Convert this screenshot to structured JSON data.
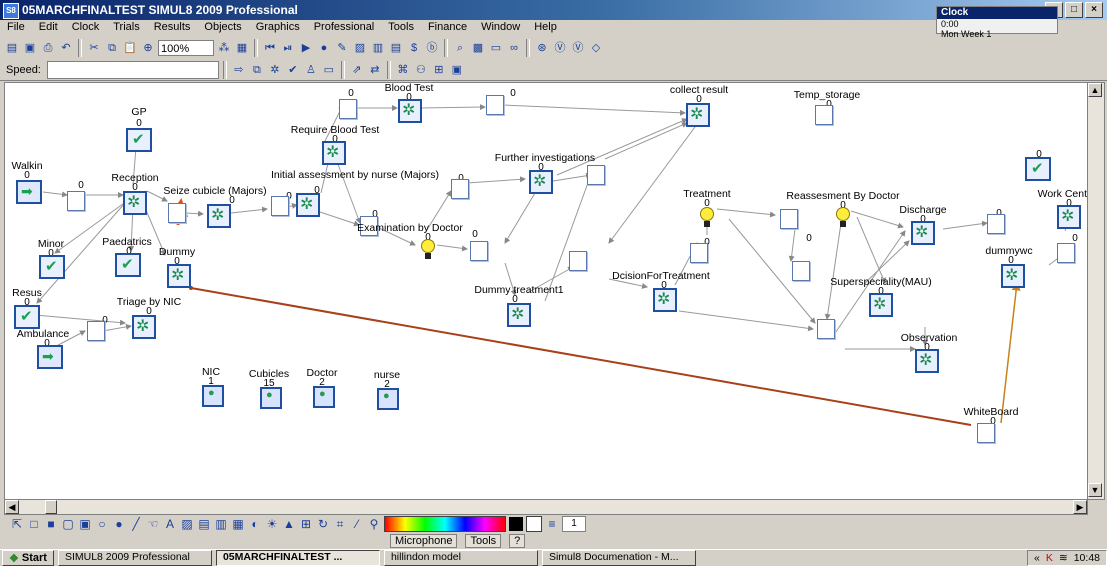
{
  "window": {
    "title": "05MARCHFINALTEST   SIMUL8 2009 Professional",
    "app_icon": "simul8-icon",
    "controls": [
      "_",
      "□",
      "×"
    ]
  },
  "clock_panel": {
    "title": "Clock",
    "time": "0:00",
    "day": "Mon   Week 1"
  },
  "menu": [
    "File",
    "Edit",
    "Clock",
    "Trials",
    "Results",
    "Objects",
    "Graphics",
    "Professional",
    "Tools",
    "Finance",
    "Window",
    "Help"
  ],
  "toolbar": {
    "zoom": "100%",
    "speed_label": "Speed:"
  },
  "model": {
    "labels": {
      "gp": "GP",
      "walkin": "Walkin",
      "reception": "Reception",
      "minor": "Minor",
      "paediatrics": "Paedatrics",
      "dummy": "Dummy",
      "resus": "Resus",
      "triage": "Triage by NIC",
      "ambulance": "Ambulance",
      "seize": "Seize cubicle (Majors)",
      "initial": "Initial assessment by nurse (Majors)",
      "require_blood": "Require Blood Test",
      "blood_test": "Blood Test",
      "exam": "Examination by Doctor",
      "further": "Further investigations",
      "dummy_treat": "Dummy treatment1",
      "collect": "collect result",
      "temp": "Temp_storage",
      "treatment": "Treatment",
      "decision": "DcisionForTreatment",
      "reassess": "Reassesment By Doctor",
      "discharge": "Discharge",
      "superspec": "Superspeciality(MAU)",
      "observation": "Observation",
      "work_center": "Work Center",
      "dummywc": "dummywc",
      "whiteboard": "WhiteBoard",
      "nic": "NIC",
      "cubicles": "Cubicles",
      "doctor": "Doctor",
      "nurse": "nurse"
    },
    "counts": {
      "zero": "0",
      "nic": "1",
      "cubicles": "15",
      "doctor": "2",
      "nurse": "2"
    }
  },
  "draw_toolbar": {
    "spin_value": "1"
  },
  "language_bar": {
    "microphone": "Microphone",
    "tools": "Tools"
  },
  "taskbar": {
    "start": "Start",
    "tasks": [
      "SIMUL8 2009 Professional",
      "05MARCHFINALTEST  ...",
      "hillindon model",
      "Simul8 Documenation - M..."
    ],
    "active_index": 1,
    "time": "10:48"
  }
}
